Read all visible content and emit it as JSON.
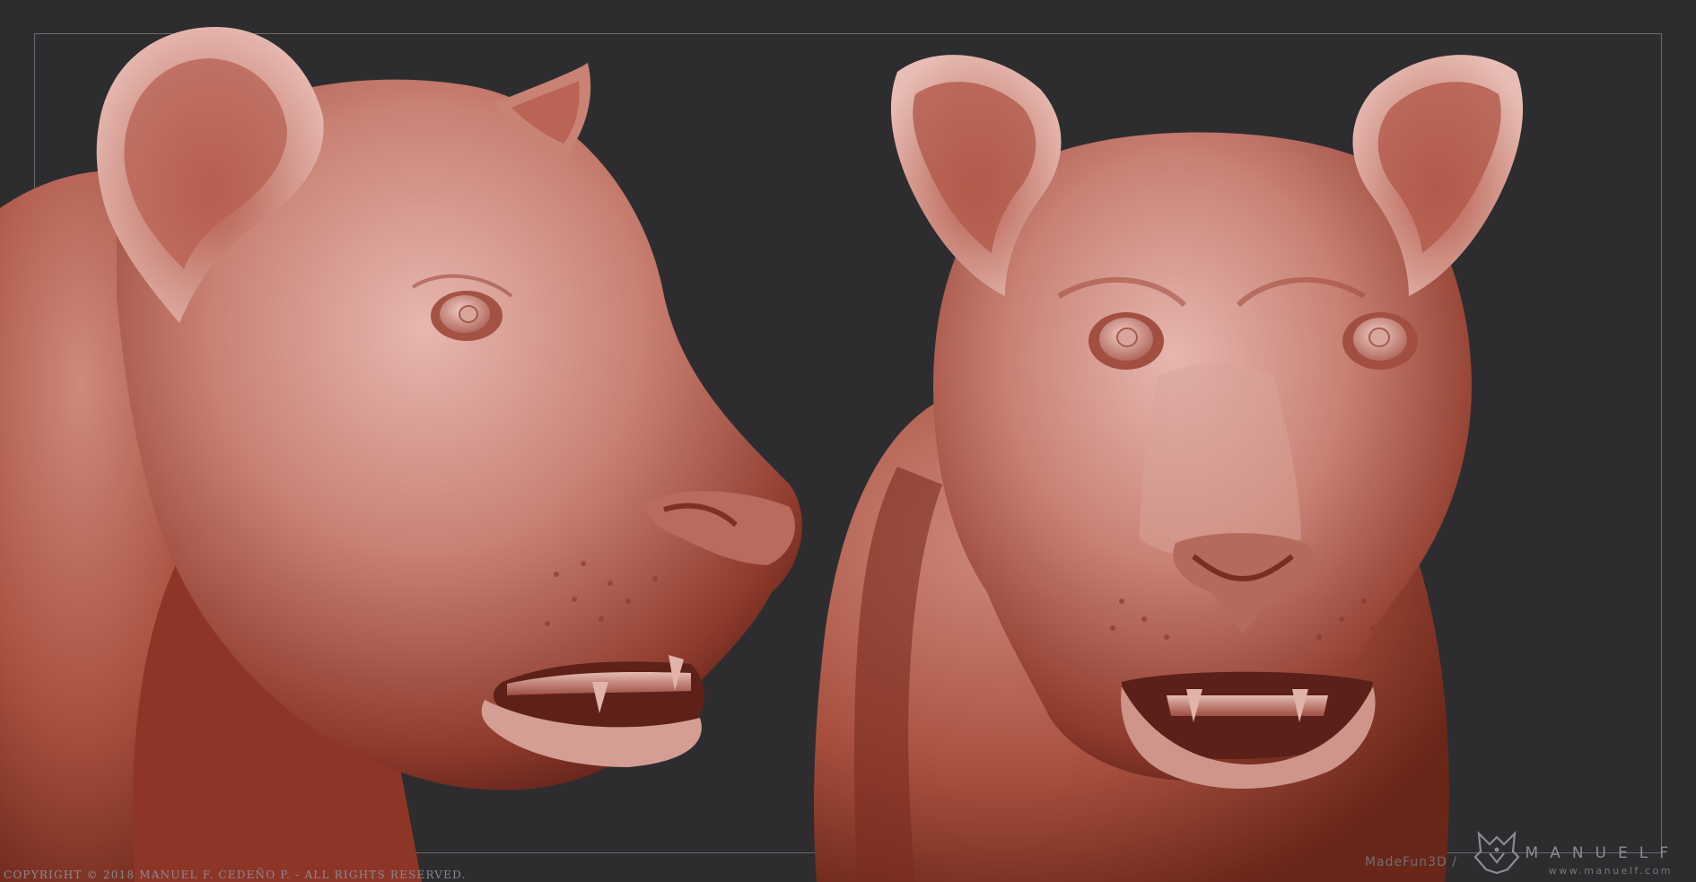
{
  "copyright": "COPYRIGHT © 2018 MANUEL F. CEDEÑO P.  - ALL RIGHTS RESERVED.",
  "watermark": {
    "prefix": "MadeFun3D /",
    "brand": "MANUELF",
    "website": "www.manuelf.com"
  },
  "colors": {
    "background": "#2d2d2f",
    "clay_light": "#e0aaa3",
    "clay_mid": "#c27466",
    "clay_dark": "#6e2a20"
  }
}
